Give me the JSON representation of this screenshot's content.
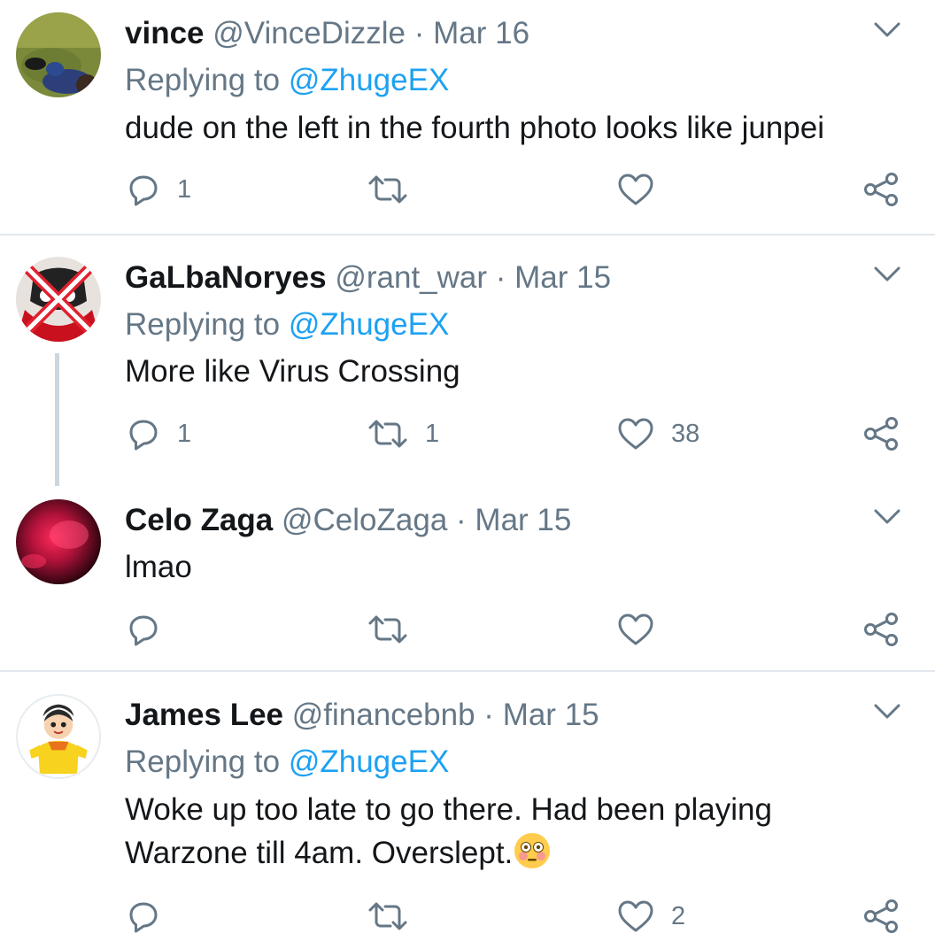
{
  "tweets": [
    {
      "name": "vince",
      "handle": "@VinceDizzle",
      "date": "Mar 16",
      "replying_prefix": "Replying to ",
      "replying_to": "@ZhugeEX",
      "text": "dude on the left in the fourth photo looks like junpei",
      "reply_count": "1",
      "retweet_count": "",
      "like_count": ""
    },
    {
      "name": "GaLbaNoryes",
      "handle": "@rant_war",
      "date": "Mar 15",
      "replying_prefix": "Replying to ",
      "replying_to": "@ZhugeEX",
      "text": "More like Virus Crossing",
      "reply_count": "1",
      "retweet_count": "1",
      "like_count": "38"
    },
    {
      "name": "Celo Zaga",
      "handle": "@CeloZaga",
      "date": "Mar 15",
      "text": "lmao",
      "reply_count": "",
      "retweet_count": "",
      "like_count": ""
    },
    {
      "name": "James Lee",
      "handle": "@financebnb",
      "date": "Mar 15",
      "replying_prefix": "Replying to ",
      "replying_to": "@ZhugeEX",
      "text_line1": "Woke up too late to go there. Had been playing",
      "text_line2": "Warzone till 4am. Overslept.",
      "reply_count": "",
      "retweet_count": "",
      "like_count": "2"
    }
  ],
  "separator": "·",
  "icons": {
    "reply": "reply-icon",
    "retweet": "retweet-icon",
    "like": "heart-icon",
    "share": "share-icon",
    "caret": "chevron-down-icon",
    "emoji": "flushed-face-emoji"
  },
  "colors": {
    "text": "#14171a",
    "secondary": "#657786",
    "link": "#1da1f2",
    "divider": "#e1e8ed",
    "thread_line": "#ccd6dd"
  }
}
